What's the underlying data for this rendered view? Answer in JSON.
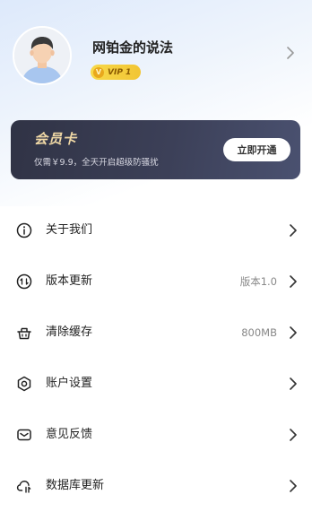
{
  "profile": {
    "username": "网铂金的说法",
    "vip_label": "VIP 1",
    "vip_coin_glyph": "V"
  },
  "member_card": {
    "title": "会员卡",
    "subtitle": "仅需￥9.9，全天开启超级防骚扰",
    "button_label": "立即开通"
  },
  "menu": {
    "items": [
      {
        "label": "关于我们",
        "value": "",
        "icon": "info-icon"
      },
      {
        "label": "版本更新",
        "value": "版本1.0",
        "icon": "update-icon"
      },
      {
        "label": "清除缓存",
        "value": "800MB",
        "icon": "basket-icon"
      },
      {
        "label": "账户设置",
        "value": "",
        "icon": "gear-icon"
      },
      {
        "label": "意见反馈",
        "value": "",
        "icon": "mail-icon"
      },
      {
        "label": "数据库更新",
        "value": "",
        "icon": "cloud-sync-icon"
      }
    ]
  },
  "colors": {
    "card_gold": "#f1d9a6",
    "card_bg": "#3c4058",
    "vip_yellow": "#f2c534"
  }
}
